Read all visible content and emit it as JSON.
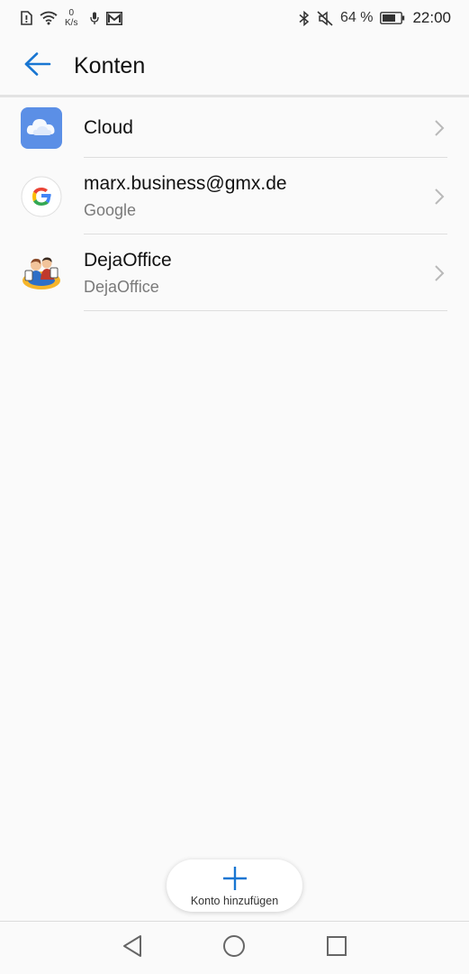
{
  "status_bar": {
    "netspeed_value": "0",
    "netspeed_unit": "K/s",
    "battery_percent": "64 %",
    "time": "22:00",
    "icons_left": [
      "alert-icon",
      "wifi-icon",
      "mic-icon",
      "mail-icon"
    ],
    "icons_right": [
      "bluetooth-icon",
      "mute-icon",
      "battery-icon"
    ]
  },
  "header": {
    "title": "Konten",
    "back_icon": "arrow-left-icon"
  },
  "accounts": [
    {
      "title": "Cloud",
      "subtitle": "",
      "icon": "cloud-icon"
    },
    {
      "title": "marx.business@gmx.de",
      "subtitle": "Google",
      "icon": "google-icon"
    },
    {
      "title": "DejaOffice",
      "subtitle": "DejaOffice",
      "icon": "dejaoffice-icon"
    }
  ],
  "add_account": {
    "label": "Konto hinzufügen",
    "icon": "plus-icon"
  },
  "nav": {
    "back": "nav-back-icon",
    "home": "nav-home-icon",
    "recents": "nav-recents-icon"
  },
  "colors": {
    "accent": "#1976d2",
    "background": "#fafafa",
    "cloud_tile": "#5b8fe6"
  }
}
